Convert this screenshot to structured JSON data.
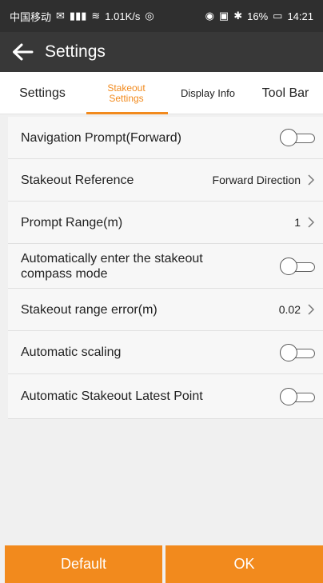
{
  "status_bar": {
    "carrier": "中国移动",
    "speed": "1.01K/s",
    "battery": "16%",
    "time": "14:21"
  },
  "app_bar": {
    "title": "Settings"
  },
  "tabs": [
    {
      "label": "Settings"
    },
    {
      "label_line1": "Stakeout",
      "label_line2": "Settings"
    },
    {
      "label": "Display Info"
    },
    {
      "label": "Tool Bar"
    }
  ],
  "rows": [
    {
      "label": "Navigation Prompt(Forward)",
      "type": "toggle"
    },
    {
      "label": "Stakeout Reference",
      "value": "Forward Direction",
      "type": "chevron"
    },
    {
      "label": "Prompt Range(m)",
      "value": "1",
      "type": "chevron"
    },
    {
      "label_line1": "Automatically enter the stakeout",
      "label_line2": "compass mode",
      "type": "toggle"
    },
    {
      "label": "Stakeout range error(m)",
      "value": "0.02",
      "type": "chevron"
    },
    {
      "label": "Automatic scaling",
      "type": "toggle"
    },
    {
      "label": "Automatic Stakeout Latest Point",
      "type": "toggle"
    }
  ],
  "bottom": {
    "default_label": "Default",
    "ok_label": "OK"
  },
  "colors": {
    "accent": "#f28a1d",
    "bar_dark": "#383838"
  }
}
